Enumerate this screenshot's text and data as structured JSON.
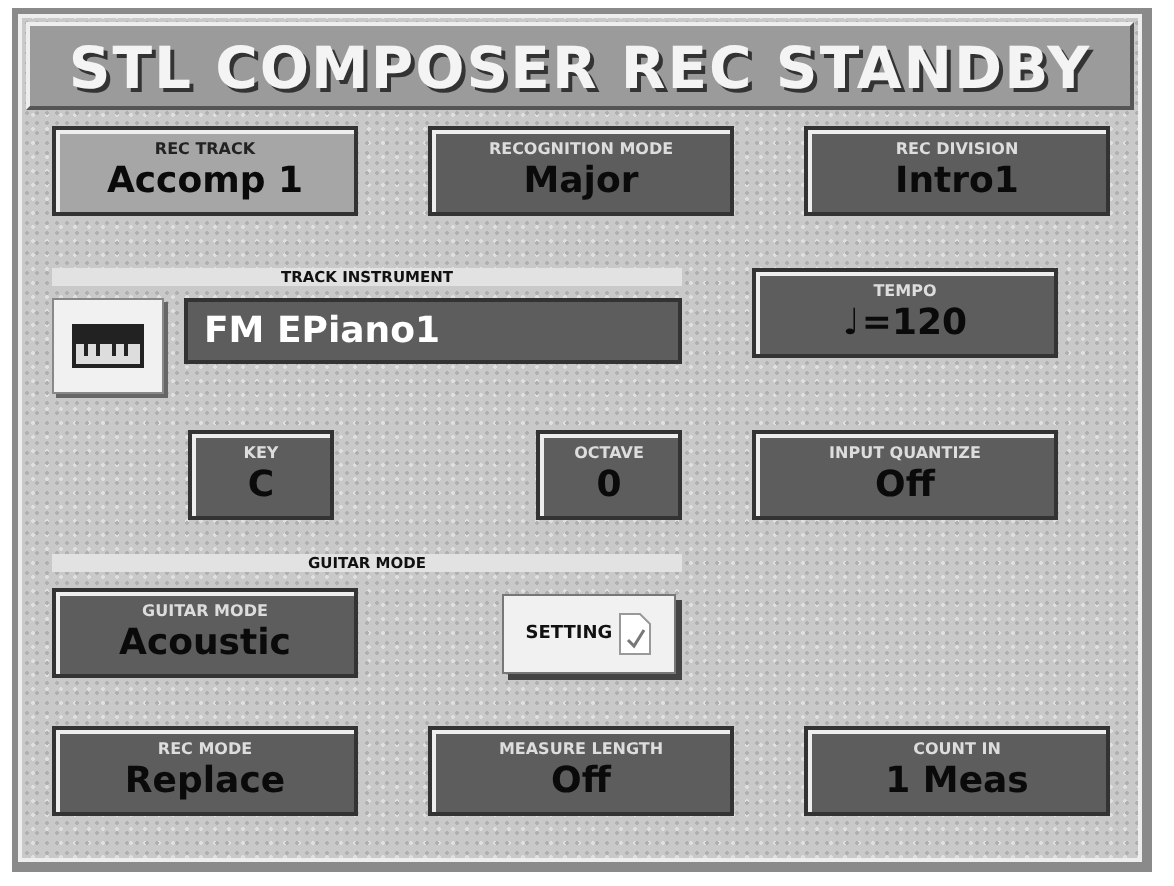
{
  "window": {
    "title": "STL COMPOSER REC STANDBY"
  },
  "top_fields": [
    {
      "label": "REC TRACK",
      "value": "Accomp 1",
      "selected": true
    },
    {
      "label": "RECOGNITION MODE",
      "value": "Major",
      "selected": false
    },
    {
      "label": "REC DIVISION",
      "value": "Intro1",
      "selected": false
    }
  ],
  "track_instrument": {
    "header": "TRACK INSTRUMENT",
    "name": "FM EPiano1",
    "selected": false
  },
  "tempo": {
    "label": "TEMPO",
    "note": "♩",
    "value": "=120",
    "selected": false
  },
  "key": {
    "label": "KEY",
    "value": "C",
    "selected": false
  },
  "octave": {
    "label": "OCTAVE",
    "value": "0",
    "selected": false
  },
  "input_quantize": {
    "label": "INPUT QUANTIZE",
    "value": "Off",
    "selected": false
  },
  "guitar": {
    "header": "GUITAR MODE",
    "field": {
      "label": "GUITAR MODE",
      "value": "Acoustic",
      "selected": false
    },
    "setting_button": "SETTING"
  },
  "bottom_fields": [
    {
      "label": "REC MODE",
      "value": "Replace",
      "selected": false
    },
    {
      "label": "MEASURE LENGTH",
      "value": "Off",
      "selected": false
    },
    {
      "label": "COUNT IN",
      "value": "1 Meas",
      "selected": false
    }
  ]
}
